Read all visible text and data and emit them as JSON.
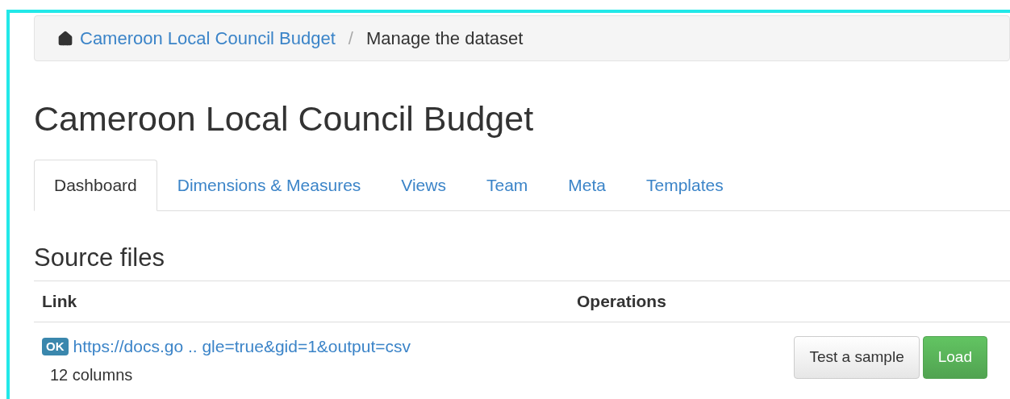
{
  "breadcrumb": {
    "items": [
      "Cameroon Local Council Budget"
    ],
    "separator": "/",
    "current": "Manage the dataset"
  },
  "title": "Cameroon Local Council Budget",
  "tabs": [
    {
      "label": "Dashboard",
      "selected": true
    },
    {
      "label": "Dimensions & Measures",
      "selected": false
    },
    {
      "label": "Views",
      "selected": false
    },
    {
      "label": "Team",
      "selected": false
    },
    {
      "label": "Meta",
      "selected": false
    },
    {
      "label": "Templates",
      "selected": false
    }
  ],
  "section_title": "Source files",
  "table": {
    "columns": [
      "Link",
      "Operations"
    ],
    "rows": [
      {
        "status": "OK",
        "link": "https://docs.go .. gle=true&gid=1&output=csv",
        "detail": "12 columns",
        "actions": [
          {
            "label": "Test a sample",
            "kind": "default"
          },
          {
            "label": "Load",
            "kind": "success"
          }
        ]
      }
    ]
  }
}
